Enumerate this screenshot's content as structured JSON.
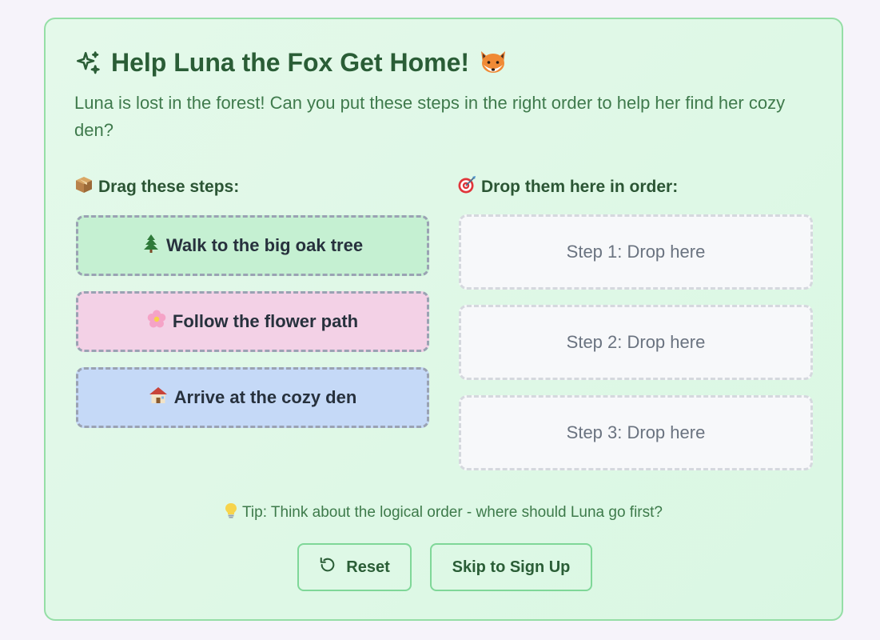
{
  "header": {
    "title": "Help Luna the Fox Get Home!",
    "title_icon": "sparkles-icon",
    "title_trailing_icon": "fox-icon",
    "subtitle": "Luna is lost in the forest! Can you put these steps in the right order to help her find her cozy den?"
  },
  "drag_section": {
    "label": "Drag these steps:",
    "icon": "package-icon"
  },
  "drop_section": {
    "label": "Drop them here in order:",
    "icon": "target-icon"
  },
  "steps": [
    {
      "label": "Walk to the big oak tree",
      "icon": "tree-icon",
      "color": "#c5f0d2"
    },
    {
      "label": "Follow the flower path",
      "icon": "flower-icon",
      "color": "#f3d1e6"
    },
    {
      "label": "Arrive at the cozy den",
      "icon": "house-icon",
      "color": "#c5d9f7"
    }
  ],
  "drop_slots": [
    {
      "label": "Step 1: Drop here"
    },
    {
      "label": "Step 2: Drop here"
    },
    {
      "label": "Step 3: Drop here"
    }
  ],
  "tip": {
    "text": "Tip: Think about the logical order - where should Luna go first?",
    "icon": "lightbulb-icon"
  },
  "buttons": {
    "reset_label": "Reset",
    "reset_icon": "reset-icon",
    "skip_label": "Skip to Sign Up"
  },
  "colors": {
    "accent": "#2a5d36",
    "card_border": "#95dea6",
    "button_border": "#7fd798"
  }
}
